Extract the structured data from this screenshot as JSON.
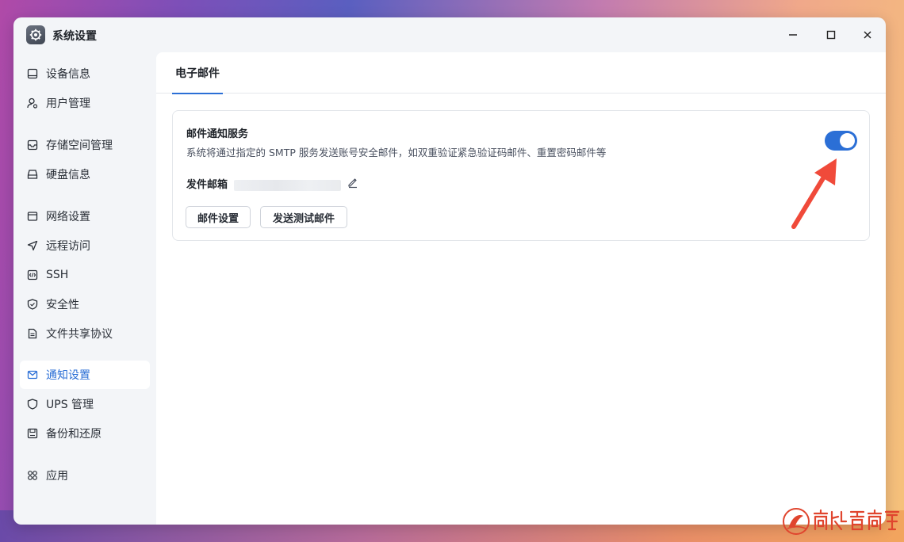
{
  "window": {
    "title": "系统设置"
  },
  "sidebar": {
    "items": [
      {
        "label": "设备信息",
        "icon": "monitor-icon"
      },
      {
        "label": "用户管理",
        "icon": "user-icon"
      },
      {
        "label": "存储空间管理",
        "icon": "storage-icon"
      },
      {
        "label": "硬盘信息",
        "icon": "disk-icon"
      },
      {
        "label": "网络设置",
        "icon": "network-icon"
      },
      {
        "label": "远程访问",
        "icon": "send-icon"
      },
      {
        "label": "SSH",
        "icon": "code-icon"
      },
      {
        "label": "安全性",
        "icon": "shield-check-icon"
      },
      {
        "label": "文件共享协议",
        "icon": "file-icon"
      },
      {
        "label": "通知设置",
        "icon": "mail-icon",
        "active": true
      },
      {
        "label": "UPS 管理",
        "icon": "shield-icon"
      },
      {
        "label": "备份和还原",
        "icon": "save-icon"
      },
      {
        "label": "应用",
        "icon": "apps-icon"
      }
    ]
  },
  "main": {
    "tabs": [
      {
        "label": "电子邮件",
        "active": true
      }
    ],
    "card": {
      "title": "邮件通知服务",
      "description": "系统将通过指定的 SMTP 服务发送账号安全邮件，如双重验证紧急验证码邮件、重置密码邮件等",
      "sender_label": "发件邮箱",
      "toggle_on": true,
      "buttons": {
        "settings": "邮件设置",
        "test": "发送测试邮件"
      }
    }
  },
  "colors": {
    "accent": "#2b6fd6",
    "annotation_arrow": "#f04a3a"
  }
}
